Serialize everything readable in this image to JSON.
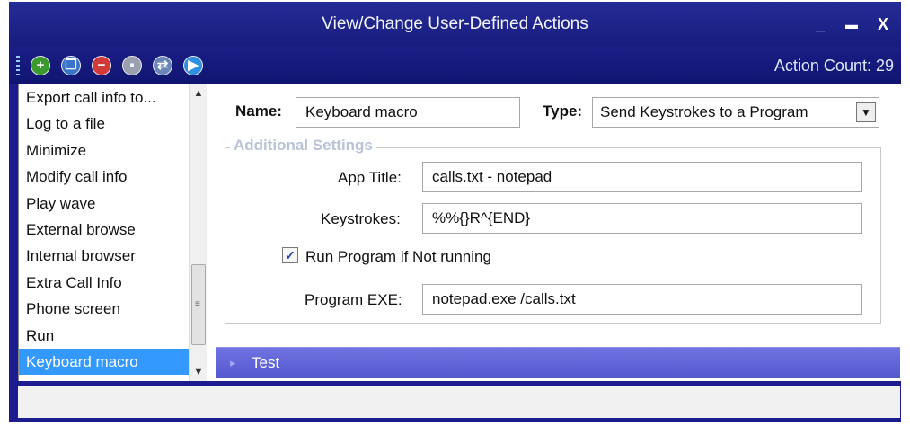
{
  "window": {
    "title": "View/Change User-Defined Actions",
    "minimize": "_",
    "maximize": "▬",
    "close": "X"
  },
  "toolbar": {
    "tools": [
      {
        "icon": "add-icon",
        "glyph": "+",
        "color": "#3a9a2e"
      },
      {
        "icon": "copy-icon",
        "glyph": "❐",
        "color": "#3a74c8"
      },
      {
        "icon": "delete-icon",
        "glyph": "−",
        "color": "#d23a3a"
      },
      {
        "icon": "save-icon",
        "glyph": "▪",
        "color": "#9aa0b0"
      },
      {
        "icon": "export-icon",
        "glyph": "⇄",
        "color": "#6a86b8"
      },
      {
        "icon": "play-icon",
        "glyph": "▶",
        "color": "#2f8fe0"
      }
    ],
    "action_count": "Action Count: 29"
  },
  "actions_list": {
    "items": [
      "Export call info to...",
      "Log to a file",
      "Minimize",
      "Modify call info",
      "Play wave",
      "External browse",
      "Internal browser",
      "Extra Call Info",
      "Phone screen",
      "Run",
      "Keyboard macro"
    ],
    "selected_index": 10
  },
  "form": {
    "name_label": "Name:",
    "name_value": "Keyboard macro",
    "type_label": "Type:",
    "type_value": "Send Keystrokes to a Program",
    "group_title": "Additional Settings",
    "app_title_label": "App Title:",
    "app_title_value": "calls.txt - notepad",
    "keystrokes_label": "Keystrokes:",
    "keystrokes_value": "%%{}R^{END}",
    "run_checkbox_label": "Run Program if Not running",
    "run_checked": true,
    "program_exe_label": "Program EXE:",
    "program_exe_value": "notepad.exe /calls.txt"
  },
  "test_section": {
    "label": "Test"
  }
}
